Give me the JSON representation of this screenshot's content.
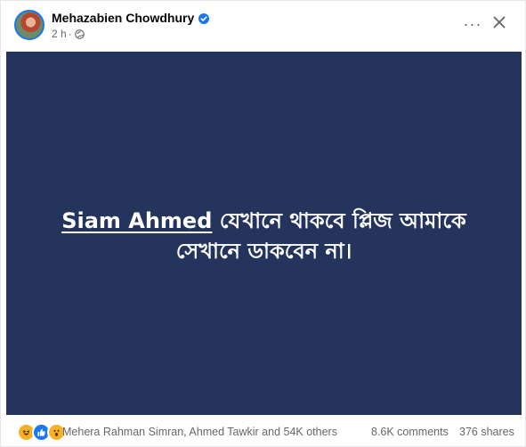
{
  "post": {
    "author": "Mehazabien Chowdhury",
    "time": "2 h",
    "separator": "·",
    "image_text_mention": "Siam Ahmed",
    "image_text_line1_rest": " যেখানে থাকবে প্লিজ আমাকে",
    "image_text_line2": "সেখানে ডাকবেন না।",
    "image_bg_color": "#24345c"
  },
  "reactions": {
    "names": "Mehera Rahman Simran, Ahmed Tawkir and 54K others",
    "types": [
      "haha-icon",
      "like-icon",
      "wow-icon"
    ]
  },
  "stats": {
    "comments": "8.6K comments",
    "shares": "376 shares"
  },
  "header_actions": {
    "more": "···"
  }
}
